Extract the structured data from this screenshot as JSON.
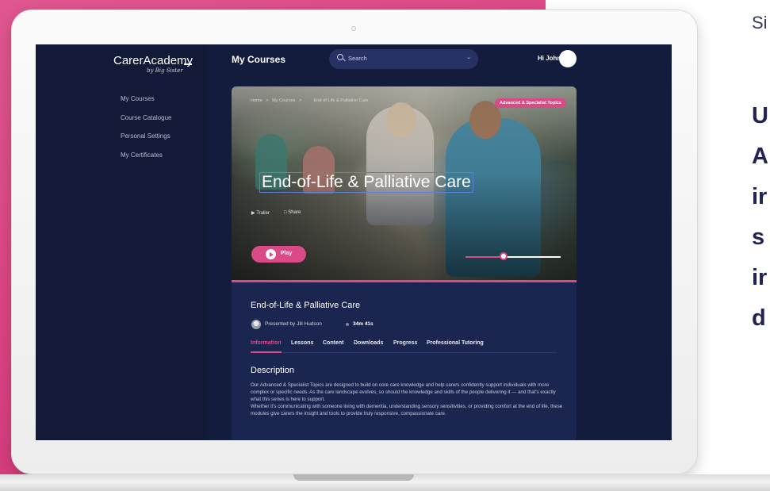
{
  "right_text": {
    "signature": "Si",
    "lines": [
      "U",
      "A",
      "ir",
      "s",
      "ir",
      "d"
    ]
  },
  "app": {
    "logo": "CarerAcademy",
    "logo_sub": "by Big Sister",
    "page_title": "My Courses",
    "search": {
      "placeholder": "Search"
    },
    "greeting": "Hi John"
  },
  "sidebar": {
    "items": [
      {
        "label": "My Courses"
      },
      {
        "label": "Course Catalogue"
      },
      {
        "label": "Personal Settings"
      },
      {
        "label": "My Certificates"
      }
    ]
  },
  "hero": {
    "breadcrumb": [
      "Home",
      ">",
      "My Courses",
      ">",
      "End-of-Life & Palliative Care"
    ],
    "badge": "Advanced & Specialist Topics",
    "title": "End-of-Life & Palliative Care",
    "trailer_label": "Trailer",
    "share_label": "Share",
    "play_label": "Play",
    "volume_level": 0.4
  },
  "course": {
    "title": "End-of-Life & Palliative Care",
    "presenter": "Presented by Jill Hudson",
    "duration": "34m 41s",
    "tabs": [
      {
        "label": "Information",
        "active": true
      },
      {
        "label": "Lessons"
      },
      {
        "label": "Content"
      },
      {
        "label": "Downloads"
      },
      {
        "label": "Progress"
      },
      {
        "label": "Professional Tutoring"
      }
    ],
    "description_title": "Description",
    "description": [
      "Our Advanced & Specialist Topics are designed to build on core care knowledge and help carers confidently support individuals with more complex or specific needs. As the care landscape evolves, so should the knowledge and skills of the people delivering it — and that's exactly what this series is here to support.",
      "Whether it's communicating with someone living with dementia, understanding sensory sensitivities, or providing comfort at the end of life, these modules give carers the insight and tools to provide truly responsive, compassionate care."
    ]
  },
  "colors": {
    "accent": "#d94a87",
    "sidebar": "#121a38",
    "panel": "#1a2650",
    "background_pink": "#dd4b86"
  }
}
